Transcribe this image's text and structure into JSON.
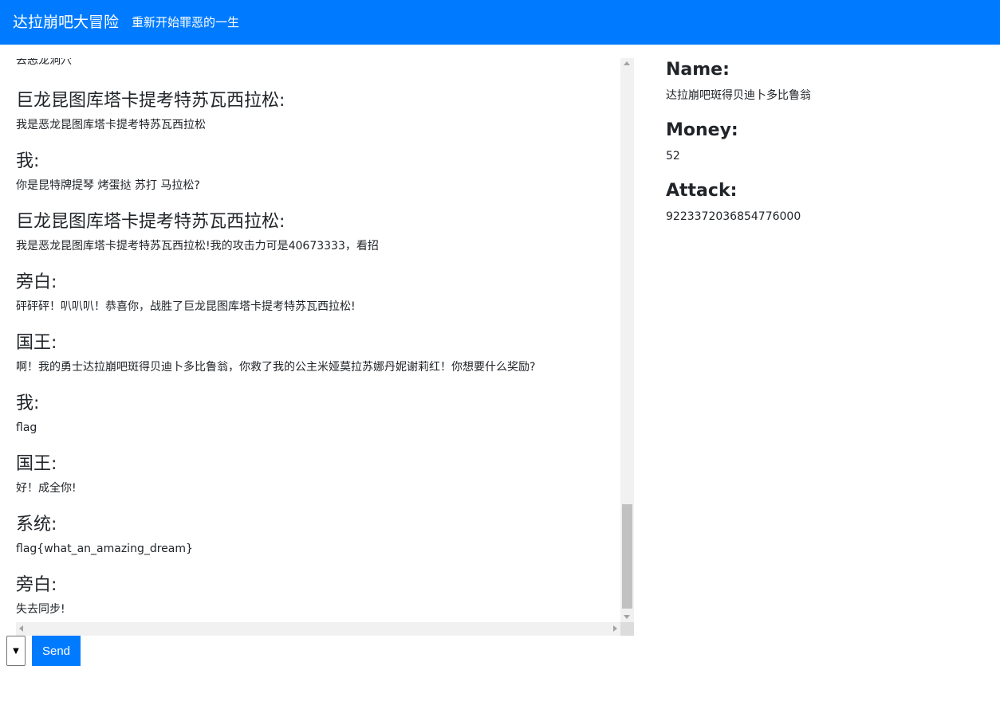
{
  "app": {
    "title": "达拉崩吧大冒险",
    "subtitle": "重新开始罪恶的一生",
    "accent_color": "#007bff"
  },
  "chat": {
    "messages": [
      {
        "speaker": "",
        "text": "去恶龙洞穴"
      },
      {
        "speaker": "巨龙昆图库塔卡提考特苏瓦西拉松:",
        "text": "我是恶龙昆图库塔卡提考特苏瓦西拉松"
      },
      {
        "speaker": "我:",
        "text": "你是昆特牌提琴 烤蛋挞 苏打 马拉松?"
      },
      {
        "speaker": "巨龙昆图库塔卡提考特苏瓦西拉松:",
        "text": "我是恶龙昆图库塔卡提考特苏瓦西拉松!我的攻击力可是40673333，看招"
      },
      {
        "speaker": "旁白:",
        "text": "砰砰砰！叭叭叭！恭喜你，战胜了巨龙昆图库塔卡提考特苏瓦西拉松!"
      },
      {
        "speaker": "国王:",
        "text": "啊！我的勇士达拉崩吧斑得贝迪卜多比鲁翁，你救了我的公主米娅莫拉苏娜丹妮谢莉红！你想要什么奖励?"
      },
      {
        "speaker": "我:",
        "text": "flag"
      },
      {
        "speaker": "国王:",
        "text": "好！成全你!"
      },
      {
        "speaker": "系统:",
        "text": "flag{what_an_amazing_dream}"
      },
      {
        "speaker": "旁白:",
        "text": "失去同步!"
      }
    ]
  },
  "controls": {
    "select_value": "",
    "send_label": "Send"
  },
  "stats": {
    "name_label": "Name:",
    "name_value": "达拉崩吧斑得贝迪卜多比鲁翁",
    "money_label": "Money:",
    "money_value": "52",
    "attack_label": "Attack:",
    "attack_value": "9223372036854776000"
  }
}
